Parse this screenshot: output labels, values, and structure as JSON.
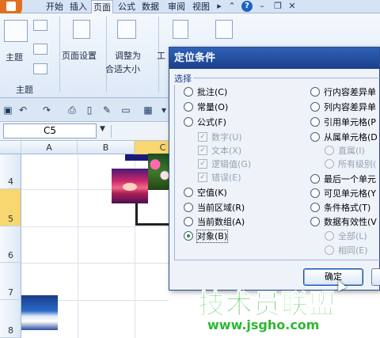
{
  "tabs": [
    {
      "label": "开始",
      "active": false
    },
    {
      "label": "插入",
      "active": false
    },
    {
      "label": "页面",
      "active": true
    },
    {
      "label": "公式",
      "active": false
    },
    {
      "label": "数据",
      "active": false
    },
    {
      "label": "审阅",
      "active": false
    },
    {
      "label": "视图",
      "active": false
    }
  ],
  "ribbon": {
    "theme_label": "主题",
    "theme_group_label": "主题",
    "page_setup_label": "页面设置",
    "fit_label_1": "调整为",
    "fit_label_2": "合适大小",
    "options_label": "工"
  },
  "name_box": "C5",
  "columns": [
    "A",
    "B",
    "C"
  ],
  "rows": [
    "4",
    "5",
    "6",
    "7",
    "8"
  ],
  "selected_column": "C",
  "selected_row": "5",
  "dialog": {
    "title": "定位条件",
    "group_label": "选择",
    "left_options": [
      {
        "label": "批注(C)",
        "type": "radio",
        "selected": false,
        "enabled": true
      },
      {
        "label": "常量(O)",
        "type": "radio",
        "selected": false,
        "enabled": true
      },
      {
        "label": "公式(F)",
        "type": "radio",
        "selected": false,
        "enabled": true
      },
      {
        "label": "数字(U)",
        "type": "checkbox",
        "checked": true,
        "enabled": false
      },
      {
        "label": "文本(X)",
        "type": "checkbox",
        "checked": true,
        "enabled": false
      },
      {
        "label": "逻辑值(G)",
        "type": "checkbox",
        "checked": true,
        "enabled": false
      },
      {
        "label": "错误(E)",
        "type": "checkbox",
        "checked": true,
        "enabled": false
      },
      {
        "label": "空值(K)",
        "type": "radio",
        "selected": false,
        "enabled": true
      },
      {
        "label": "当前区域(R)",
        "type": "radio",
        "selected": false,
        "enabled": true
      },
      {
        "label": "当前数组(A)",
        "type": "radio",
        "selected": false,
        "enabled": true
      },
      {
        "label": "对象(B)",
        "type": "radio",
        "selected": true,
        "enabled": true
      }
    ],
    "right_options": [
      {
        "label": "行内容差异单",
        "type": "radio",
        "selected": false,
        "enabled": true
      },
      {
        "label": "列内容差异单",
        "type": "radio",
        "selected": false,
        "enabled": true
      },
      {
        "label": "引用单元格(P",
        "type": "radio",
        "selected": false,
        "enabled": true
      },
      {
        "label": "从属单元格(D",
        "type": "radio",
        "selected": false,
        "enabled": true
      },
      {
        "label": "直属(I)",
        "type": "radio",
        "selected": true,
        "enabled": false
      },
      {
        "label": "所有级别(",
        "type": "radio",
        "selected": false,
        "enabled": false
      },
      {
        "label": "最后一个单元",
        "type": "radio",
        "selected": false,
        "enabled": true
      },
      {
        "label": "可见单元格(Y",
        "type": "radio",
        "selected": false,
        "enabled": true
      },
      {
        "label": "条件格式(T)",
        "type": "radio",
        "selected": false,
        "enabled": true
      },
      {
        "label": "数据有效性(V",
        "type": "radio",
        "selected": false,
        "enabled": true
      },
      {
        "label": "全部(L)",
        "type": "radio",
        "selected": true,
        "enabled": false
      },
      {
        "label": "相同(E)",
        "type": "radio",
        "selected": false,
        "enabled": false
      }
    ],
    "ok_label": "确定"
  },
  "watermark": {
    "text": "技术员联盟",
    "url": "www.jsgho.com"
  }
}
